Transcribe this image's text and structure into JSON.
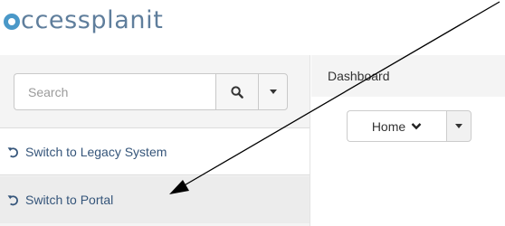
{
  "brand": {
    "logo_text": "ccessplanit",
    "logo_mark_icon": "access-circle-icon",
    "logo_color": "#5f7e9c",
    "mark_color": "#4a98c8"
  },
  "sidebar": {
    "search": {
      "placeholder": "Search",
      "search_icon": "magnifier-icon",
      "dropdown_icon": "caret-down-icon"
    },
    "items": [
      {
        "label": "Switch to Legacy System",
        "icon": "undo-arrow-icon"
      },
      {
        "label": "Switch to Portal",
        "icon": "undo-arrow-icon",
        "highlighted": true
      }
    ],
    "link_color": "#35557a"
  },
  "main": {
    "breadcrumb": "Dashboard",
    "home_dropdown": {
      "label": "Home",
      "chevron_icon": "chevron-down-icon",
      "split_caret_icon": "caret-down-icon"
    }
  },
  "annotation": {
    "arrow_icon": "pointer-arrow-icon",
    "arrow_color": "#000000"
  }
}
